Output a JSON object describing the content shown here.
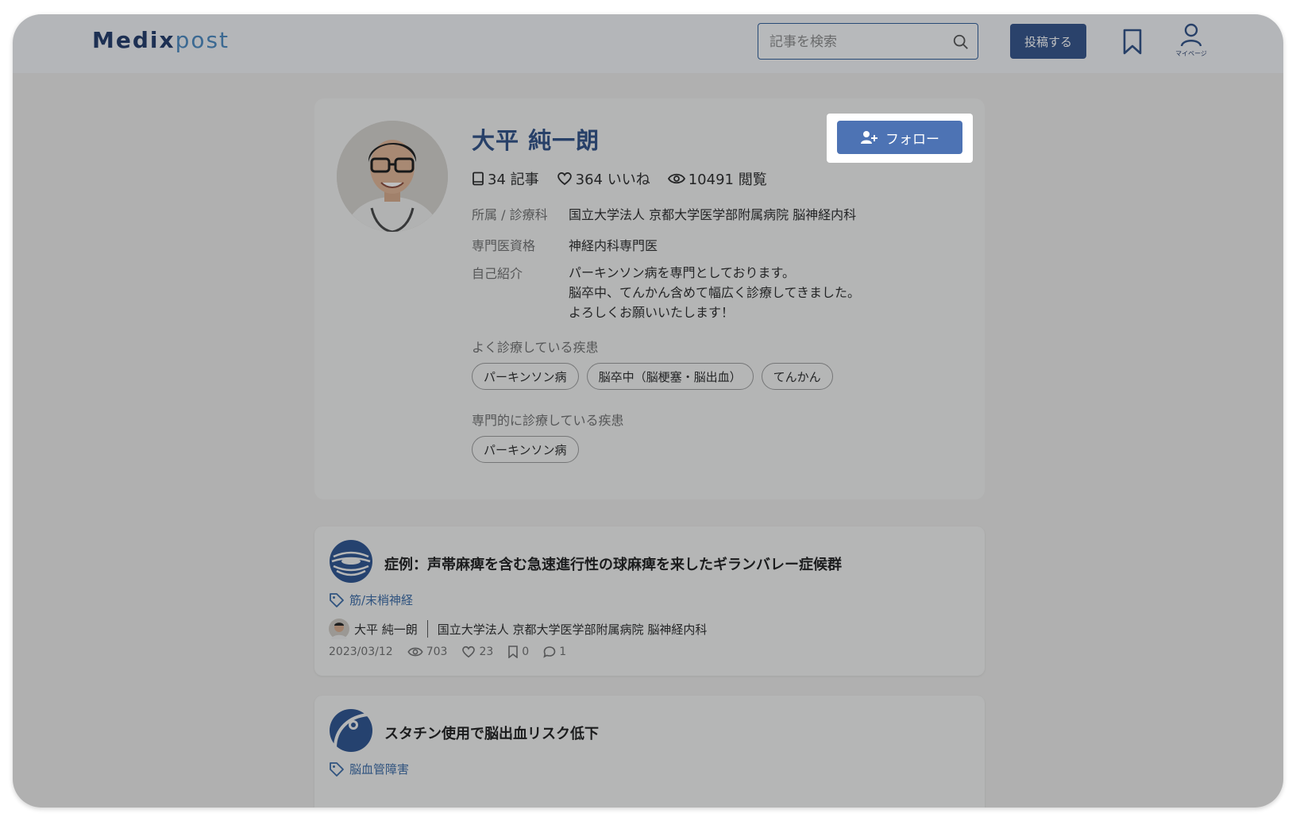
{
  "header": {
    "logo_part1": "Medix",
    "logo_part2": "post",
    "search_placeholder": "記事を検索",
    "post_label": "投稿する",
    "mypage_label": "マイページ"
  },
  "profile": {
    "name": "大平 純一朗",
    "follow_label": "フォロー",
    "stats": {
      "articles": "34 記事",
      "likes": "364 いいね",
      "views": "10491 閲覧"
    },
    "affiliation_label": "所属 / 診療科",
    "affiliation_value": "国立大学法人 京都大学医学部附属病院 脳神経内科",
    "specialist_label": "専門医資格",
    "specialist_value": "神経内科専門医",
    "intro_label": "自己紹介",
    "intro_lines": [
      "パーキンソン病を専門としております。",
      "脳卒中、てんかん含めて幅広く診療してきました。",
      "よろしくお願いいたします！"
    ],
    "common_diseases_label": "よく診療している疾患",
    "common_diseases": [
      "パーキンソン病",
      "脳卒中（脳梗塞・脳出血）",
      "てんかん"
    ],
    "specialty_diseases_label": "専門的に診療している疾患",
    "specialty_diseases": [
      "パーキンソン病"
    ]
  },
  "articles": [
    {
      "title": "症例：声帯麻痺を含む急速進行性の球麻痺を来したギランバレー症候群",
      "tag": "筋/末梢神経",
      "author": "大平 純一朗",
      "affiliation": "国立大学法人 京都大学医学部附属病院 脳神経内科",
      "date": "2023/03/12",
      "views": "703",
      "likes": "23",
      "bookmarks": "0",
      "comments": "1"
    },
    {
      "title": "スタチン使用で脳出血リスク低下",
      "tag": "脳血管障害"
    }
  ],
  "colors": {
    "brand": "#2f4f86",
    "button": "#4d73b4",
    "tag": "#3a6aa5"
  }
}
